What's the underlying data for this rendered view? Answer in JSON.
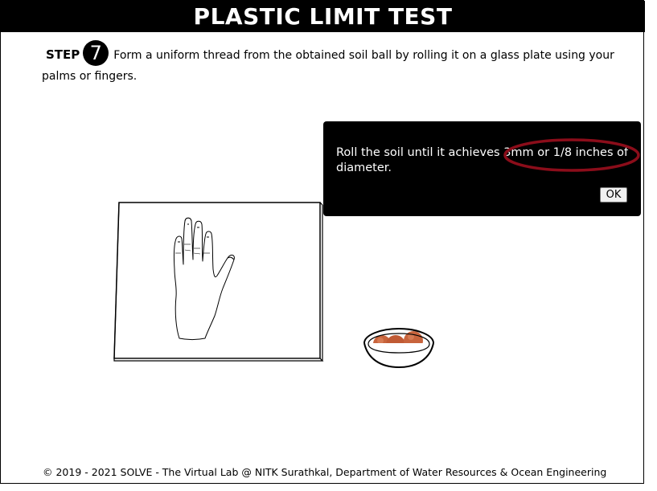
{
  "header": {
    "title": "PLASTIC LIMIT TEST"
  },
  "step": {
    "label": "STEP",
    "number": "7",
    "instruction": "Form a uniform thread from the obtained soil ball by rolling it on a glass plate using your palms or fingers."
  },
  "dialog": {
    "text_before": "Roll the soil until it achieves ",
    "highlight": "3mm or 1/8 inches",
    "text_after": " of diameter.",
    "ok_label": "OK"
  },
  "footer": {
    "text": "© 2019 - 2021 SOLVE - The Virtual Lab @ NITK Surathkal, Department of Water Resources & Ocean Engineering"
  },
  "colors": {
    "title_bg": "#000000",
    "dialog_bg": "#000000",
    "highlight_ring": "#8b0d1a",
    "soil": "#c8643c"
  }
}
